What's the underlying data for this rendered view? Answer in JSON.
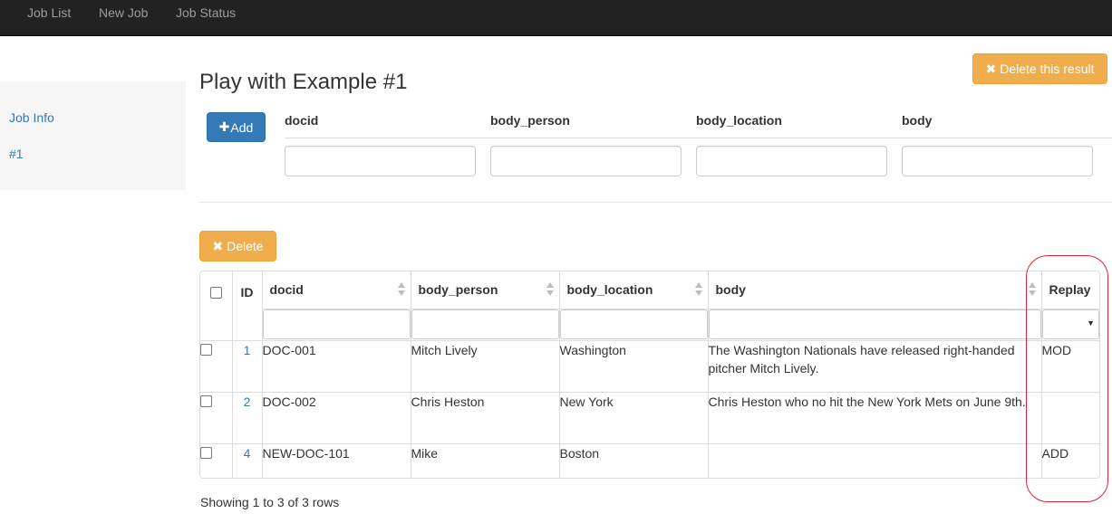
{
  "navbar": {
    "items": [
      {
        "label": "Job List"
      },
      {
        "label": "New Job"
      },
      {
        "label": "Job Status"
      }
    ],
    "background_color": "#222222"
  },
  "sidebar": {
    "items": [
      {
        "label": "Job Info"
      },
      {
        "label": "#1"
      }
    ]
  },
  "page": {
    "title": "Play with Example #1",
    "delete_result_label": "Delete this result",
    "delete_result_icon": "close-icon"
  },
  "add_form": {
    "add_label": "Add",
    "add_icon": "plus-icon",
    "fields": [
      {
        "label": "docid",
        "value": ""
      },
      {
        "label": "body_person",
        "value": ""
      },
      {
        "label": "body_location",
        "value": ""
      },
      {
        "label": "body",
        "value": ""
      }
    ]
  },
  "table": {
    "delete_label": "Delete",
    "delete_icon": "close-icon",
    "columns": {
      "id": "ID",
      "docid": "docid",
      "body_person": "body_person",
      "body_location": "body_location",
      "body": "body",
      "replay": "Replay"
    },
    "filters": {
      "docid": "",
      "body_person": "",
      "body_location": "",
      "body": "",
      "replay_selected": ""
    },
    "rows": [
      {
        "id": "1",
        "docid": "DOC-001",
        "body_person": "Mitch Lively",
        "body_location": "Washington",
        "body": "The Washington Nationals have released right-handed pitcher Mitch Lively.",
        "replay": "MOD"
      },
      {
        "id": "2",
        "docid": "DOC-002",
        "body_person": "Chris Heston",
        "body_location": "New York",
        "body": "Chris Heston who no hit the New York Mets on June 9th.",
        "replay": ""
      },
      {
        "id": "4",
        "docid": "NEW-DOC-101",
        "body_person": "Mike",
        "body_location": "Boston",
        "body": "",
        "replay": "ADD"
      }
    ],
    "pagination_text": "Showing 1 to 3 of 3 rows"
  },
  "colors": {
    "primary": "#337ab7",
    "warning": "#f0ad4e",
    "link": "#337ab7",
    "annotation": "#d9263f"
  }
}
